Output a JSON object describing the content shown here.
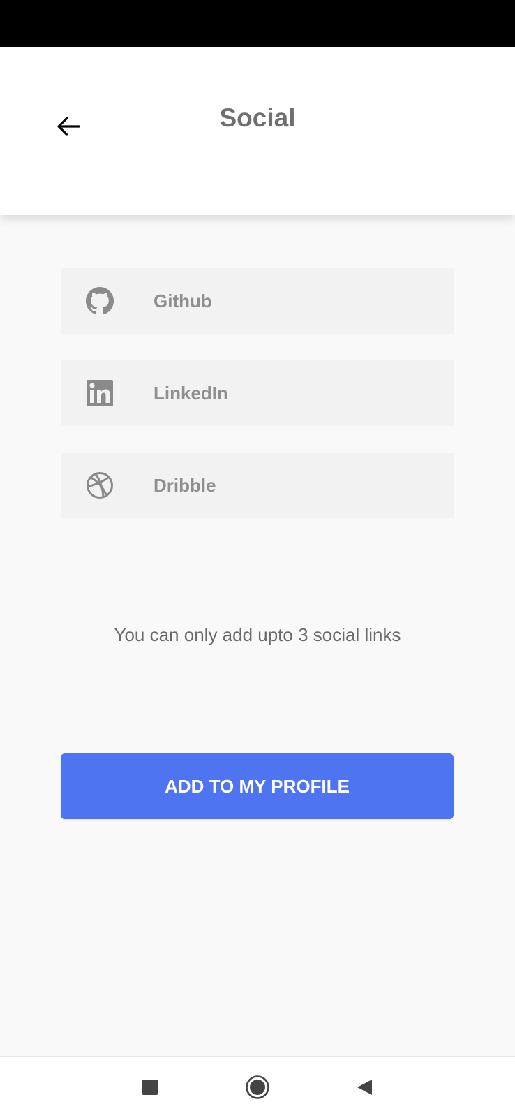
{
  "app_bar": {
    "title": "Social",
    "back_icon": "arrow-left-icon"
  },
  "social_links": [
    {
      "label": "Github",
      "icon": "github-icon"
    },
    {
      "label": "LinkedIn",
      "icon": "linkedin-icon"
    },
    {
      "label": "Dribble",
      "icon": "dribbble-icon"
    }
  ],
  "info_text": "You can only add upto 3 social links",
  "primary_button": {
    "label": "ADD TO MY PROFILE"
  },
  "nav": {
    "recents_icon": "square-icon",
    "home_icon": "circle-icon",
    "back_icon": "triangle-back-icon"
  },
  "colors": {
    "primary": "#4e74f2",
    "background": "#f9f9f9",
    "card": "#f2f2f2",
    "icon_gray": "#8a8a8a",
    "title_gray": "#6f6f6f"
  }
}
